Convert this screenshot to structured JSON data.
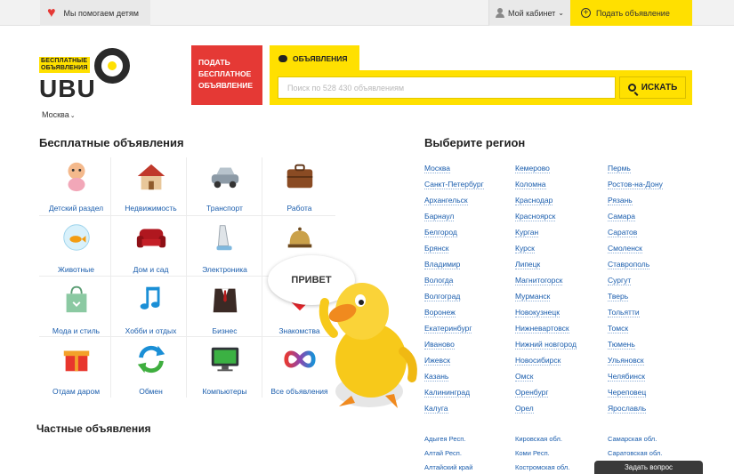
{
  "topbar": {
    "help_text": "Мы помогаем детям",
    "cabinet_label": "Мой кабинет",
    "post_label": "Подать объявление"
  },
  "logo": {
    "tag_line1": "БЕСПЛАТНЫЕ",
    "tag_line2": "ОБЪЯВЛЕНИЯ",
    "word": "UBU",
    "city": "Москва"
  },
  "post_button": "ПОДАТЬ БЕСПЛАТНОЕ ОБЪЯВЛЕНИЕ",
  "search": {
    "tab_label": "ОБЪЯВЛЕНИЯ",
    "placeholder": "Поиск по 528 430 объявлениям",
    "button_label": "ИСКАТЬ"
  },
  "categories": {
    "title": "Бесплатные объявления",
    "items": [
      {
        "label": "Детский раздел",
        "icon": "baby-icon"
      },
      {
        "label": "Недвижимость",
        "icon": "house-icon"
      },
      {
        "label": "Транспорт",
        "icon": "car-icon"
      },
      {
        "label": "Работа",
        "icon": "briefcase-icon"
      },
      {
        "label": "Животные",
        "icon": "fish-icon"
      },
      {
        "label": "Дом и сад",
        "icon": "sofa-icon"
      },
      {
        "label": "Электроника",
        "icon": "iron-icon"
      },
      {
        "label": "",
        "icon": "bell-icon"
      },
      {
        "label": "Мода и стиль",
        "icon": "shopping-bag-icon"
      },
      {
        "label": "Хобби и отдых",
        "icon": "music-note-icon"
      },
      {
        "label": "Бизнес",
        "icon": "suit-icon"
      },
      {
        "label": "Знакомства",
        "icon": "heart-icon"
      },
      {
        "label": "Отдам даром",
        "icon": "gift-icon"
      },
      {
        "label": "Обмен",
        "icon": "exchange-arrows-icon"
      },
      {
        "label": "Компьютеры",
        "icon": "monitor-icon"
      },
      {
        "label": "Все объявления",
        "icon": "infinity-icon"
      }
    ]
  },
  "private_title": "Частные объявления",
  "regions": {
    "title": "Выберите регион",
    "col1": [
      "Москва",
      "Санкт-Петербург",
      "Архангельск",
      "Барнаул",
      "Белгород",
      "Брянск",
      "Владимир",
      "Вологда",
      "Волгоград",
      "Воронеж",
      "Екатеринбург",
      "Иваново",
      "Ижевск",
      "Казань",
      "Калининград",
      "Калуга"
    ],
    "col2": [
      "Кемерово",
      "Коломна",
      "Краснодар",
      "Красноярск",
      "Курган",
      "Курск",
      "Липецк",
      "Магнитогорск",
      "Мурманск",
      "Новокузнецк",
      "Нижневартовск",
      "Нижний новгород",
      "Новосибирск",
      "Омск",
      "Оренбург",
      "Орел"
    ],
    "col3": [
      "Пермь",
      "Ростов-на-Дону",
      "Рязань",
      "Самара",
      "Саратов",
      "Смоленск",
      "Ставрополь",
      "Сургут",
      "Тверь",
      "Тольятти",
      "Томск",
      "Тюмень",
      "Ульяновск",
      "Челябинск",
      "Череповец",
      "Ярославль"
    ],
    "oblast1": [
      "Адыгея Респ.",
      "Алтай Респ.",
      "Алтайский край"
    ],
    "oblast2": [
      "Кировская обл.",
      "Коми Респ.",
      "Костромская обл."
    ],
    "oblast3": [
      "Самарская обл.",
      "Саратовская обл."
    ]
  },
  "mascot": {
    "greeting": "ПРИВЕТ"
  },
  "feedback_button": "Задать вопрос",
  "colors": {
    "brand_yellow": "#ffe000",
    "accent_red": "#e53935",
    "link_blue": "#1a5dad"
  }
}
